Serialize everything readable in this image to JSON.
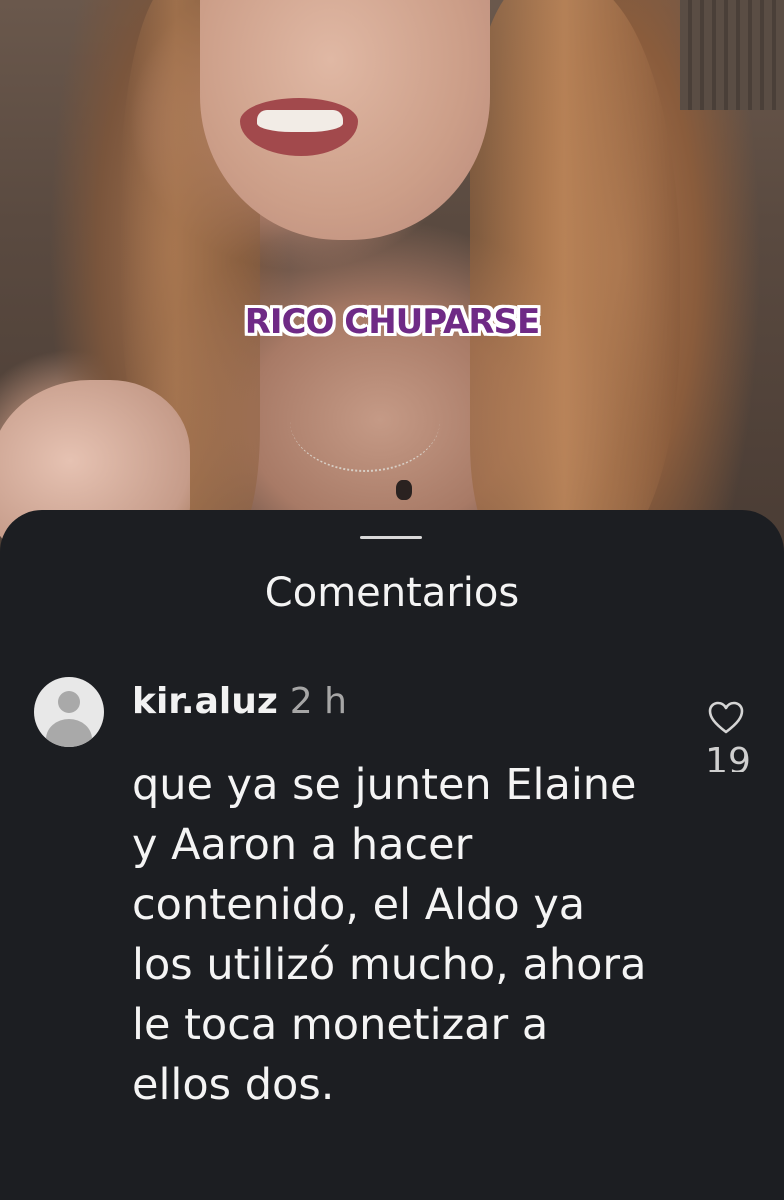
{
  "video": {
    "caption": "RICO CHUPARSE"
  },
  "comments_sheet": {
    "title": "Comentarios",
    "comments": [
      {
        "username": "kir.aluz",
        "time": "2 h",
        "text": "que ya se junten Elaine y Aaron a hacer contenido, el Aldo ya los utilizó mucho, ahora le toca monetizar a ellos dos.",
        "likes": "19",
        "like_icon": "heart-icon"
      }
    ]
  },
  "colors": {
    "sheet_background": "#1c1e22",
    "caption_text": "#6f2a86",
    "caption_outline": "#ffffff",
    "primary_text": "#f4f4f4",
    "secondary_text": "#a6a6a6"
  }
}
